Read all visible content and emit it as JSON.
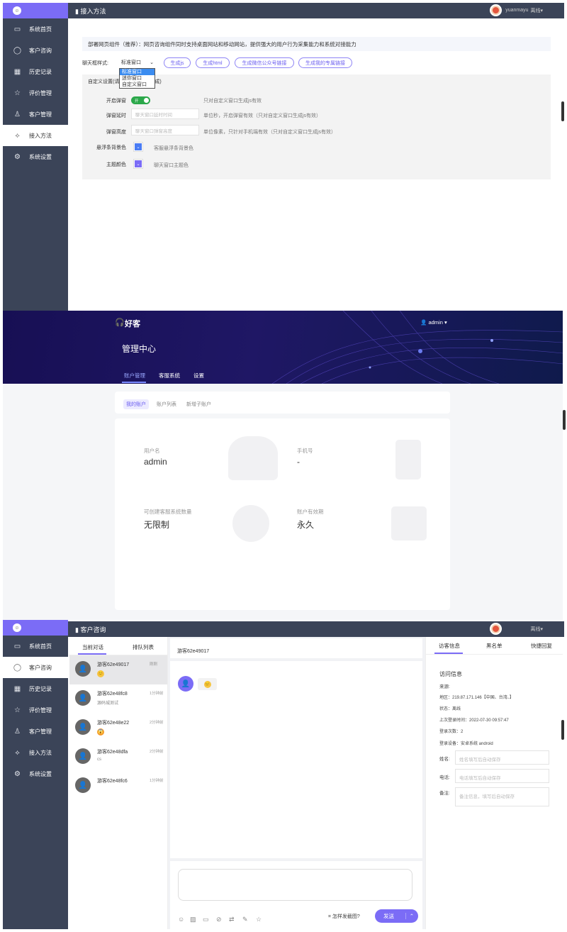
{
  "sidebar": {
    "items": [
      {
        "label": "系统首页",
        "icon": "window-icon"
      },
      {
        "label": "客户咨询",
        "icon": "chat-bubble-icon"
      },
      {
        "label": "历史记录",
        "icon": "calendar-icon"
      },
      {
        "label": "评价管理",
        "icon": "star-icon"
      },
      {
        "label": "客户管理",
        "icon": "user-icon"
      },
      {
        "label": "接入方法",
        "icon": "plug-icon"
      },
      {
        "label": "系统设置",
        "icon": "gear-icon"
      }
    ]
  },
  "page1": {
    "title": "接入方法",
    "user": "yuanmayu",
    "status": "离线",
    "notice": "部署网页组件（推荐）：网页咨询组件同时支持桌面网站和移动网站，提供强大的用户行为采集能力和系统对接能力",
    "style_label": "聊天框样式:",
    "style_selected": "标准窗口",
    "style_options": [
      "标准窗口",
      "迷你窗口",
      "自定义窗口"
    ],
    "buttons": [
      "生成js",
      "生成html",
      "生成微信公众号链接",
      "生成我的专属链接"
    ],
    "custom_title_a": "自定义设置(请",
    "custom_title_b": "成)",
    "fields": {
      "popup_label": "开启弹窗",
      "toggle_text": "开",
      "popup_hint": "只对自定义窗口生成js有效",
      "delay_label": "弹窗延时",
      "delay_placeholder": "聊天窗口延时时间",
      "delay_hint": "单位秒，开启弹窗有效（只对自定义窗口生成js有效）",
      "height_label": "弹窗高度",
      "height_placeholder": "聊天窗口弹窗高度",
      "height_hint": "单位像素，只针对手机端有效（只对自定义窗口生成js有效）",
      "bar_color_label": "悬浮条背景色",
      "bar_color_hint": "客服悬浮条背景色",
      "theme_color_label": "主题颜色",
      "theme_color_hint": "聊天窗口主题色"
    },
    "colors": {
      "bar": "#4a7cf4",
      "theme": "#7b6cf6"
    }
  },
  "page2": {
    "logo": "好客",
    "admin": "admin",
    "heading": "管理中心",
    "tabs": [
      "账户管理",
      "客服系统",
      "设置"
    ],
    "subtabs": [
      "我的账户",
      "账户列表",
      "新增子账户"
    ],
    "username_label": "用户名",
    "username": "admin",
    "phone_label": "手机号",
    "phone": "-",
    "quota_label": "可创建客服系统数量",
    "quota": "无限制",
    "expiry_label": "账户有效期",
    "expiry": "永久"
  },
  "page3": {
    "title": "客户咨询",
    "status": "离线",
    "list_tabs": [
      "当前对话",
      "排队列表"
    ],
    "conversations": [
      {
        "name": "游客62e49017",
        "msg": "😊",
        "time": "刚刚"
      },
      {
        "name": "游客62e48fc8",
        "msg": "源码城测试",
        "time": "1分钟前"
      },
      {
        "name": "游客62e48e22",
        "msg": "😱",
        "time": "2分钟前"
      },
      {
        "name": "游客62e48dfa",
        "msg": "cs",
        "time": "2分钟前"
      },
      {
        "name": "游客62e48fc6",
        "msg": "",
        "time": "1分钟前"
      }
    ],
    "chat_title": "游客62e49017",
    "chat_msg": "😊",
    "screenshot_hint": "怎样发截图?",
    "send": "发送",
    "right_tabs": [
      "访客信息",
      "黑名单",
      "快捷回复"
    ],
    "visitor": {
      "heading": "访问信息",
      "source": "来源:",
      "region": "地区：219.87.171.146【中国、台湾、】",
      "state": "状态：离线",
      "last_login": "上次登录时间：2022-07-30 09:57:47",
      "login_count": "登录次数：2",
      "device": "登录设备：安卓系统 android",
      "name_label": "姓名:",
      "name_placeholder": "姓名填写后自动保存",
      "phone_label": "电话:",
      "phone_placeholder": "电话填写后自动保存",
      "note_label": "备注:",
      "note_placeholder": "备注信息，填写后自动保存"
    }
  }
}
